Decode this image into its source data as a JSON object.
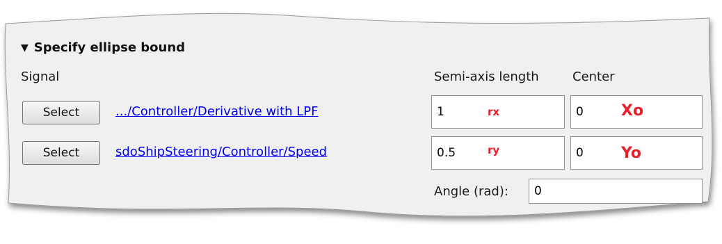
{
  "section": {
    "title": "Specify ellipse bound",
    "toggle_icon": "triangle-down-icon"
  },
  "headers": {
    "signal": "Signal",
    "semi_axis": "Semi-axis length",
    "center": "Center"
  },
  "rows": [
    {
      "button": "Select",
      "signal": ".../Controller/Derivative with LPF",
      "semi_axis": "1",
      "semi_axis_tag": "rx",
      "center": "0",
      "center_tag": "Xo"
    },
    {
      "button": "Select",
      "signal": "sdoShipSteering/Controller/Speed",
      "semi_axis": "0.5",
      "semi_axis_tag": "ry",
      "center": "0",
      "center_tag": "Yo"
    }
  ],
  "angle": {
    "label": "Angle (rad):",
    "value": "0"
  },
  "colors": {
    "link": "#0000ee",
    "annotation": "#e8202a",
    "panel": "#f0f0f0"
  }
}
